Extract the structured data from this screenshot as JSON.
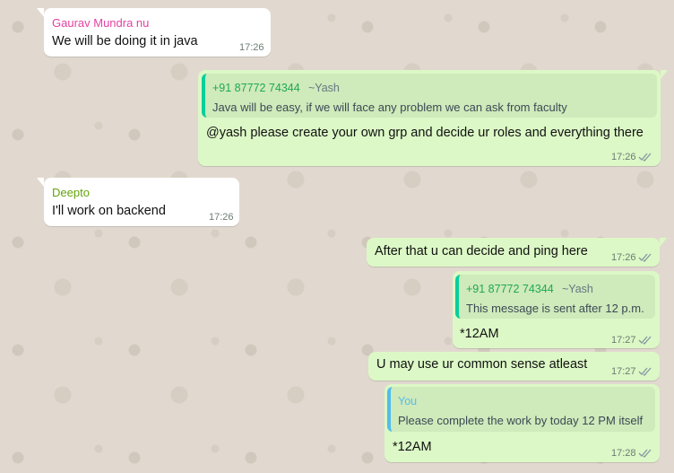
{
  "colors": {
    "incoming_bg": "#ffffff",
    "outgoing_bg": "#dcf8c6",
    "chat_bg": "#e1d9cf",
    "sender_gaurav": "#e542a3",
    "sender_deepto": "#65a30d",
    "quote_bar_contact": "#06cf9c",
    "quote_bar_you": "#53bdeb",
    "tick_color": "#8696a0"
  },
  "messages": [
    {
      "sender": "Gaurav Mundra nu",
      "text": "We will be doing it in java",
      "time": "17:26"
    },
    {
      "quote": {
        "phone": "+91 87772 74344",
        "name": "~Yash",
        "text": "Java will be easy, if we will face any problem we can ask from faculty"
      },
      "text": "@yash please create your own grp and decide ur roles and everything there",
      "time": "17:26",
      "status_icon": "double-check-icon"
    },
    {
      "sender": "Deepto",
      "text": "I'll work on backend",
      "time": "17:26"
    },
    {
      "text": "After that u can decide and ping here",
      "time": "17:26",
      "status_icon": "double-check-icon"
    },
    {
      "quote": {
        "phone": "+91 87772 74344",
        "name": "~Yash",
        "text": "This message is sent after 12 p.m."
      },
      "text": "*12AM",
      "time": "17:27",
      "status_icon": "double-check-icon"
    },
    {
      "text": "U may use ur common sense atleast",
      "time": "17:27",
      "status_icon": "double-check-icon"
    },
    {
      "quote": {
        "name": "You",
        "text": "Please complete the work by today 12 PM itself"
      },
      "text": "*12AM",
      "time": "17:28",
      "status_icon": "double-check-icon"
    }
  ]
}
